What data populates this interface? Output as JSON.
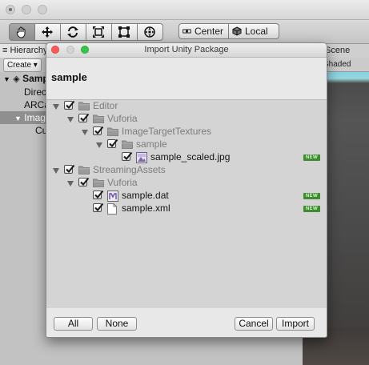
{
  "main_window": {
    "toolbar": {
      "tools": [
        {
          "icon": "hand-icon"
        },
        {
          "icon": "move-icon"
        },
        {
          "icon": "rotate-icon"
        },
        {
          "icon": "scale-icon"
        },
        {
          "icon": "rect-tool-icon"
        },
        {
          "icon": "transform-icon"
        }
      ],
      "pivot_mode": "Center",
      "pivot_rotation": "Local"
    },
    "hierarchy": {
      "tab_label": "Hierarchy",
      "create_label": "Create",
      "items": [
        "Sample",
        "Directional Light",
        "ARCamera",
        "ImageTarget",
        "Cube"
      ]
    },
    "scene": {
      "tab_label": "Scene",
      "shading_label": "Shaded"
    }
  },
  "dialog": {
    "title": "Import Unity Package",
    "package_name": "sample",
    "tree": [
      {
        "label": "Editor",
        "type": "folder",
        "checked": true,
        "expanded": true,
        "depth": 0,
        "is_new": false
      },
      {
        "label": "Vuforia",
        "type": "folder",
        "checked": true,
        "expanded": true,
        "depth": 1,
        "is_new": false
      },
      {
        "label": "ImageTargetTextures",
        "type": "folder",
        "checked": true,
        "expanded": true,
        "depth": 2,
        "is_new": false
      },
      {
        "label": "sample",
        "type": "folder",
        "checked": true,
        "expanded": true,
        "depth": 3,
        "is_new": false
      },
      {
        "label": "sample_scaled.jpg",
        "type": "image",
        "checked": true,
        "expanded": false,
        "depth": 4,
        "is_new": true
      },
      {
        "label": "StreamingAssets",
        "type": "folder",
        "checked": true,
        "expanded": true,
        "depth": 0,
        "is_new": false
      },
      {
        "label": "Vuforia",
        "type": "folder",
        "checked": true,
        "expanded": true,
        "depth": 1,
        "is_new": false
      },
      {
        "label": "sample.dat",
        "type": "dat",
        "checked": true,
        "expanded": false,
        "depth": 2,
        "is_new": true
      },
      {
        "label": "sample.xml",
        "type": "file",
        "checked": true,
        "expanded": false,
        "depth": 2,
        "is_new": true
      }
    ],
    "new_badge": "NEW",
    "buttons": {
      "all": "All",
      "none": "None",
      "cancel": "Cancel",
      "import": "Import"
    }
  }
}
